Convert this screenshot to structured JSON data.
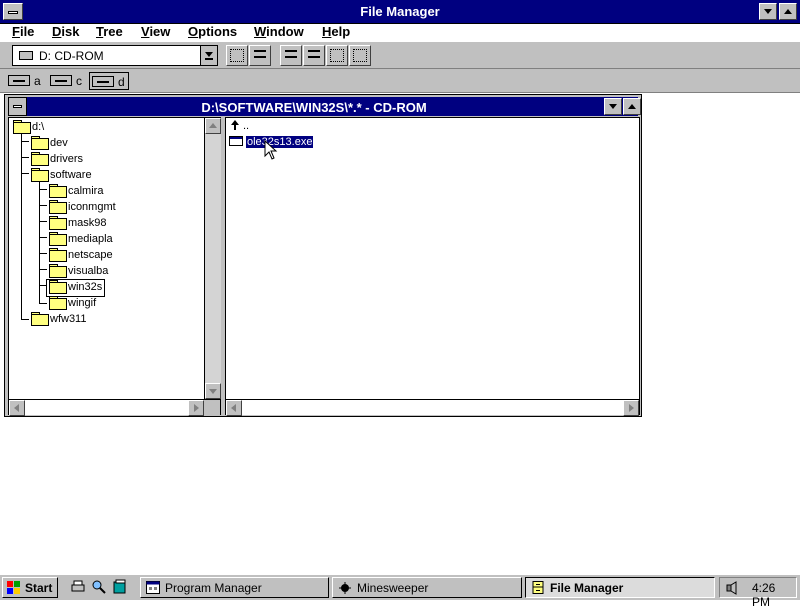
{
  "window": {
    "title": "File Manager"
  },
  "menu": [
    "File",
    "Disk",
    "Tree",
    "View",
    "Options",
    "Window",
    "Help"
  ],
  "toolbar": {
    "drive_value": "D: CD-ROM"
  },
  "drives": [
    {
      "letter": "a",
      "selected": false
    },
    {
      "letter": "c",
      "selected": false
    },
    {
      "letter": "d",
      "selected": true
    }
  ],
  "child": {
    "title": "D:\\SOFTWARE\\WIN32S\\*.* - CD-ROM"
  },
  "tree": [
    {
      "label": "d:\\",
      "depth": 0
    },
    {
      "label": "dev",
      "depth": 1
    },
    {
      "label": "drivers",
      "depth": 1
    },
    {
      "label": "software",
      "depth": 1
    },
    {
      "label": "calmira",
      "depth": 2
    },
    {
      "label": "iconmgmt",
      "depth": 2
    },
    {
      "label": "mask98",
      "depth": 2
    },
    {
      "label": "mediapla",
      "depth": 2
    },
    {
      "label": "netscape",
      "depth": 2
    },
    {
      "label": "visualba",
      "depth": 2
    },
    {
      "label": "win32s",
      "depth": 2,
      "selected": true
    },
    {
      "label": "wingif",
      "depth": 2
    },
    {
      "label": "wfw311",
      "depth": 1
    }
  ],
  "files": [
    {
      "label": "..",
      "type": "updir"
    },
    {
      "label": "ole32s13.exe",
      "type": "exe",
      "selected": true
    }
  ],
  "taskbar": {
    "start_label": "Start",
    "tasks": [
      {
        "label": "Program Manager",
        "active": false
      },
      {
        "label": "Minesweeper",
        "active": false
      },
      {
        "label": "File Manager",
        "active": true
      }
    ],
    "clock": "4:26 PM"
  },
  "colors": {
    "titlebar": "#000080",
    "face": "#c0c0c0",
    "selection": "#000080"
  }
}
